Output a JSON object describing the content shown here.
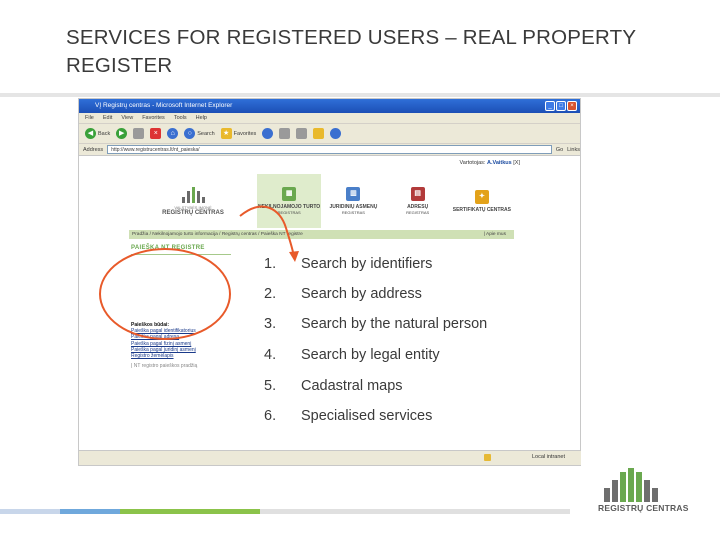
{
  "slide": {
    "title": "SERVICES FOR REGISTERED USERS – REAL PROPERTY REGISTER"
  },
  "browser": {
    "window_title": "VĮ Registrų centras - Microsoft Internet Explorer",
    "menu": [
      "File",
      "Edit",
      "View",
      "Favorites",
      "Tools",
      "Help"
    ],
    "toolbar": {
      "back_label": "Back",
      "search_label": "Search",
      "favorites_label": "Favorites"
    },
    "address_label": "Address",
    "address_value": "http://www.registrucentras.lt/nt_paieska/",
    "go_label": "Go",
    "links_label": "Links",
    "status_zone": "Local intranet"
  },
  "website": {
    "login_prefix": "Vartotojas:",
    "login_user": "A.Vaitkus",
    "login_exit": "[X]",
    "logo_caption_top": "VALSTYBĖS ĮMONĖ",
    "logo_caption_main": "REGISTRŲ CENTRAS",
    "tabs": [
      {
        "label": "NEKILNOJAMOJO TURTO",
        "sub": "REGISTRAS",
        "color": "#6aa84f",
        "active": true
      },
      {
        "label": "JURIDINIŲ ASMENŲ",
        "sub": "REGISTRAS",
        "color": "#4a7fc9",
        "active": false
      },
      {
        "label": "ADRESŲ",
        "sub": "REGISTRAS",
        "color": "#b23a3a",
        "active": false
      },
      {
        "label": "SERTIFIKATŲ CENTRAS",
        "sub": "",
        "color": "#e3a21a",
        "active": false
      }
    ],
    "breadcrumb": "Pradžia / Nekilnojamojo turto informacija / Registrų centras / Paieška NT registre",
    "breadcrumb_right": "| Apie mus",
    "section_head": "PAIEŠKA NT REGISTRE",
    "search_menu": {
      "title": "Paieškos būdai:",
      "items": [
        "Paieška pagal identifikatorius",
        "Paieška pagal adresą",
        "Paieška pagal fizinį asmenį",
        "Paieška pagal juridinį asmenį",
        "Registro žemėlapis"
      ],
      "footer": "Į NT registro paieškos pradžią"
    }
  },
  "services": [
    {
      "num": "1.",
      "label": "Search by identifiers"
    },
    {
      "num": "2.",
      "label": "Search by address"
    },
    {
      "num": "3.",
      "label": "Search by the natural person"
    },
    {
      "num": "4.",
      "label": "Search by legal entity"
    },
    {
      "num": "5.",
      "label": "Cadastral maps"
    },
    {
      "num": "6.",
      "label": "Specialised services"
    }
  ],
  "brand": {
    "name": "REGISTRŲ CENTRAS",
    "gray": "#6e6e6e",
    "green": "#6aa84f"
  },
  "colors": {
    "annotation": "#e85a2a",
    "strip": [
      "#c8d6ea",
      "#6fa8dc",
      "#8bc34a",
      "#e0e0e0"
    ]
  }
}
